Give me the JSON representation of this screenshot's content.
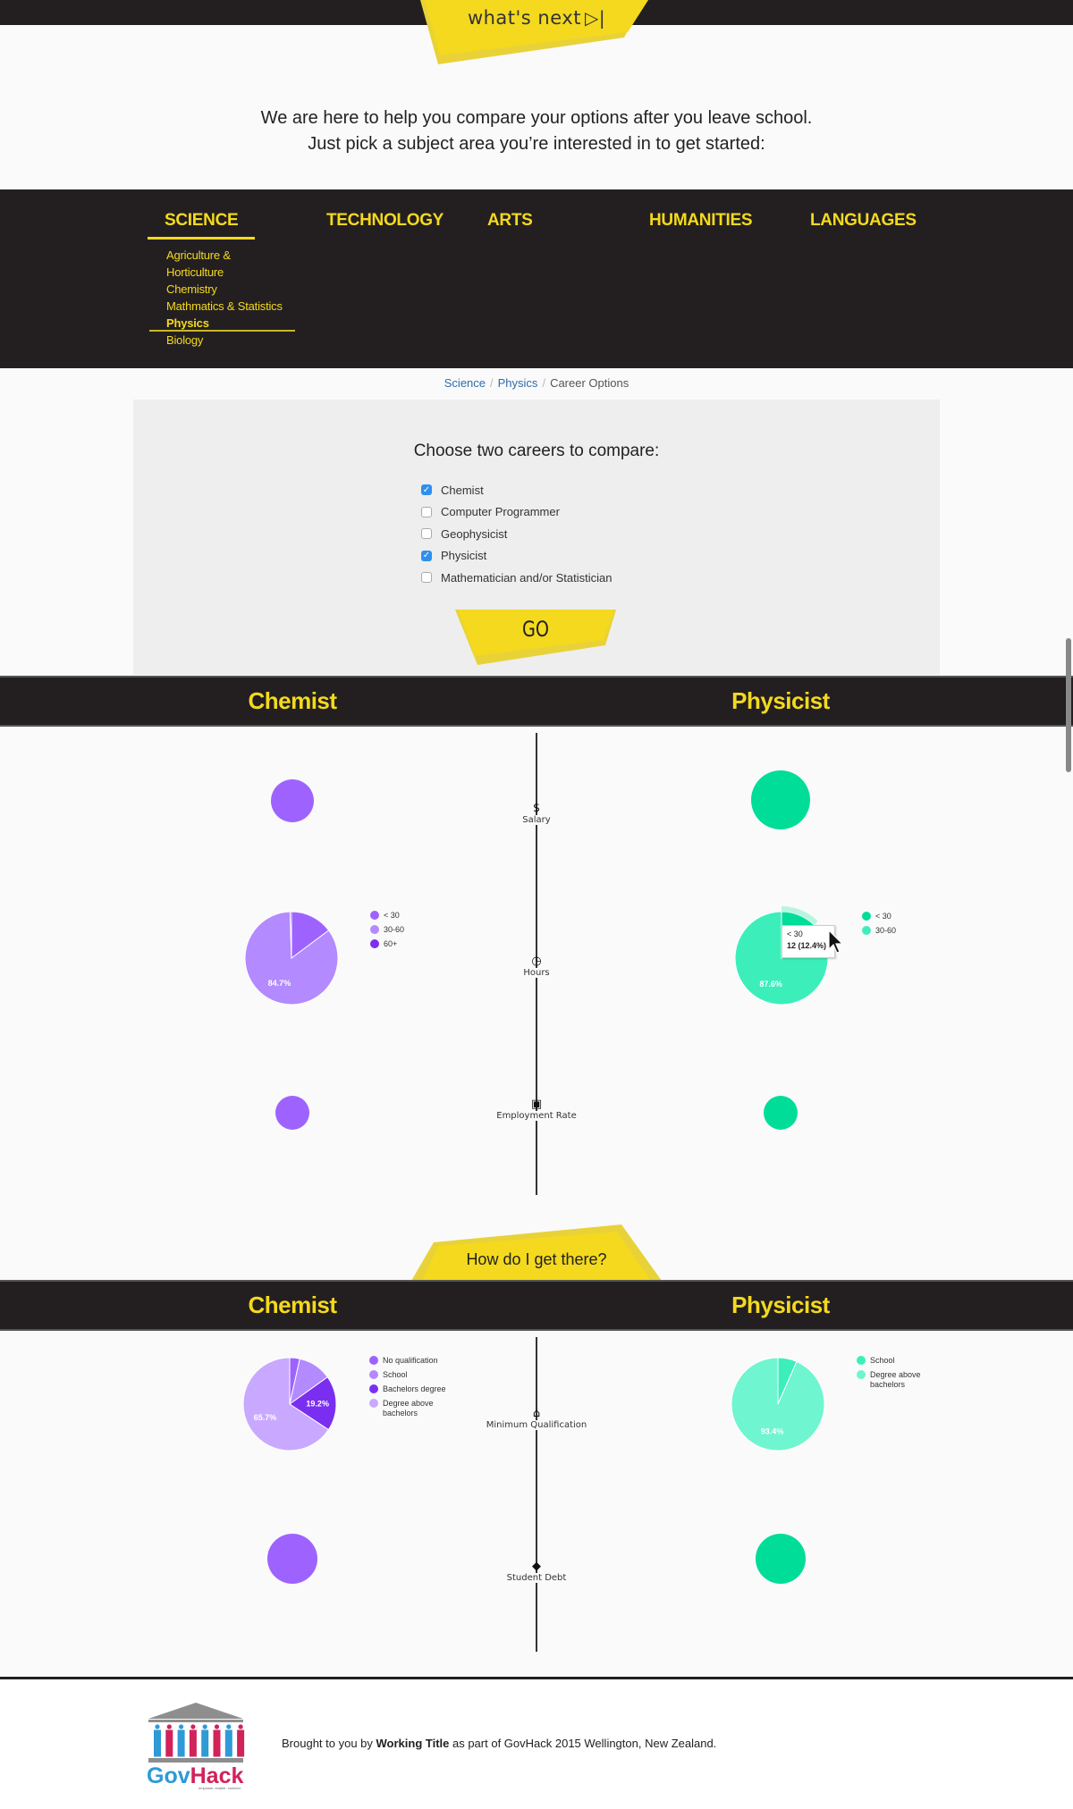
{
  "top_tab": {
    "label": "what's next",
    "icon": "play-skip-icon"
  },
  "intro": {
    "line1": "We are here to help you compare your options after you leave school.",
    "line2": "Just pick a subject area you’re interested in to get started:"
  },
  "nav": {
    "items": [
      {
        "label": "SCIENCE",
        "active": true
      },
      {
        "label": "TECHNOLOGY"
      },
      {
        "label": "ARTS"
      },
      {
        "label": "HUMANITIES"
      },
      {
        "label": "LANGUAGES"
      }
    ],
    "science_subitems": [
      {
        "label": "Agriculture &"
      },
      {
        "label": "Horticulture"
      },
      {
        "label": "Chemistry"
      },
      {
        "label": "Mathmatics & Statistics"
      },
      {
        "label": "Physics",
        "active": true
      },
      {
        "label": "Biology"
      }
    ]
  },
  "breadcrumb": {
    "items": [
      "Science",
      "Physics",
      "Career Options"
    ],
    "separator": "/"
  },
  "compare": {
    "title": "Choose two careers to compare:",
    "options": [
      {
        "label": "Chemist",
        "checked": true
      },
      {
        "label": "Computer Programmer",
        "checked": false
      },
      {
        "label": "Geophysicist",
        "checked": false
      },
      {
        "label": "Physicist",
        "checked": true
      },
      {
        "label": "Mathematician and/or Statistician",
        "checked": false
      }
    ],
    "go_label": "GO"
  },
  "careers": {
    "left": "Chemist",
    "right": "Physicist"
  },
  "colors": {
    "yellow": "#f4d91e",
    "dark": "#231f20",
    "purple": "#9e63ff",
    "green": "#00dd99",
    "link": "#2f6bb0"
  },
  "metrics_section1": [
    {
      "label": "Salary",
      "icon": "dollar-icon",
      "glyph": "$"
    },
    {
      "label": "Hours",
      "icon": "clock-icon",
      "glyph": "◷"
    },
    {
      "label": "Employment Rate",
      "icon": "briefcase-icon",
      "glyph": "▣"
    }
  ],
  "section2_tab": "How do I get there?",
  "metrics_section2": [
    {
      "label": "Minimum Qualification",
      "icon": "graduation-cap-icon",
      "glyph": "⌂"
    },
    {
      "label": "Student Debt",
      "icon": "tags-icon",
      "glyph": "◆"
    }
  ],
  "tooltip": {
    "label": "< 30",
    "value": "12 (12.4%)"
  },
  "chart_data": [
    {
      "type": "pie",
      "title": "Chemist - Hours",
      "categories": [
        "< 30",
        "30-60",
        "60+"
      ],
      "values": [
        14.8,
        84.7,
        0.5
      ],
      "colors": [
        "#9e63ff",
        "#b38aff",
        "#7a2ff0"
      ],
      "data_labels": [
        "",
        "84.7%",
        ""
      ],
      "legend": "right"
    },
    {
      "type": "pie",
      "title": "Physicist - Hours",
      "categories": [
        "< 30",
        "30-60"
      ],
      "values": [
        12.4,
        87.6
      ],
      "colors": [
        "#00dd99",
        "#3cefba"
      ],
      "data_labels": [
        "",
        "87.6%"
      ],
      "legend": "right"
    },
    {
      "type": "pie",
      "title": "Chemist - Minimum Qualification",
      "categories": [
        "No qualification",
        "School",
        "Bachelors degree",
        "Degree above bachelors"
      ],
      "values": [
        3.5,
        11.6,
        19.2,
        65.7
      ],
      "colors": [
        "#9e63ff",
        "#b38aff",
        "#7a2ff0",
        "#c8a9ff"
      ],
      "data_labels": [
        "",
        "",
        "19.2%",
        "65.7%"
      ],
      "legend": "right"
    },
    {
      "type": "pie",
      "title": "Physicist - Minimum Qualification",
      "categories": [
        "School",
        "Degree above bachelors"
      ],
      "values": [
        6.6,
        93.4
      ],
      "colors": [
        "#3cefba",
        "#6ff5cf"
      ],
      "data_labels": [
        "",
        "93.4%"
      ],
      "legend": "right"
    }
  ],
  "bubbles": {
    "salary": {
      "chemist_relative": 0.72,
      "physicist_relative": 1.0
    },
    "employment_rate": {
      "chemist_relative": 0.57,
      "physicist_relative": 0.57
    },
    "student_debt": {
      "chemist_relative": 0.85,
      "physicist_relative": 0.85
    }
  },
  "footer": {
    "logo_text": "GovHack",
    "logo_tagline": "empower. enable. connect.",
    "text_before": "Brought to you by ",
    "text_bold": "Working Title",
    "text_after": " as part of GovHack 2015 Wellington, New Zealand."
  }
}
